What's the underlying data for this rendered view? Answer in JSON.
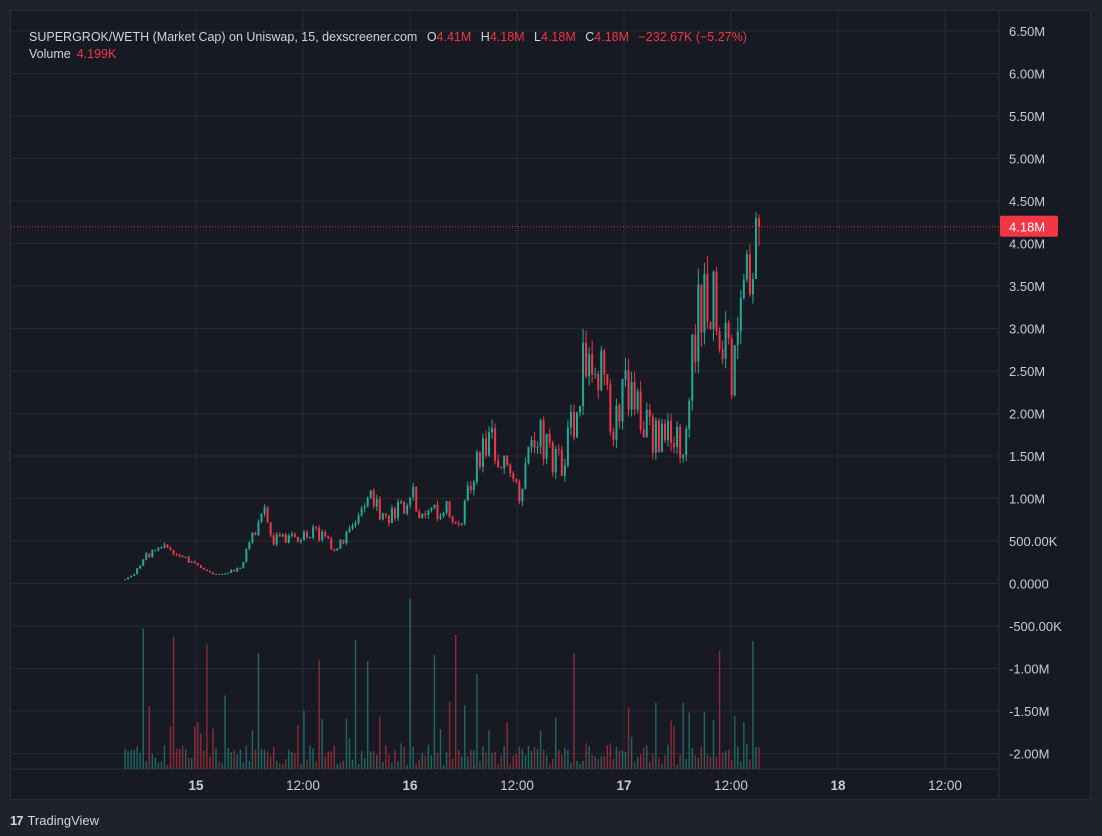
{
  "legend": {
    "title": "SUPERGROK/WETH (Market Cap) on Uniswap, 15, dexscreener.com",
    "o_label": "O",
    "o_value": "4.41M",
    "h_label": "H",
    "h_value": "4.18M",
    "l_label": "L",
    "l_value": "4.18M",
    "c_label": "C",
    "c_value": "4.18M",
    "change": "−232.67K (−5.27%)",
    "volume_label": "Volume",
    "volume_value": "4.199K"
  },
  "price_tag": "4.18M",
  "branding": {
    "name": "TradingView",
    "logo_glyph": "17"
  },
  "colors": {
    "up": "#22ab94",
    "down": "#f23645",
    "grid": "#262a35",
    "background": "#171a23"
  },
  "chart_data": {
    "type": "candlestick",
    "y_ticks": [
      "6.50M",
      "6.00M",
      "5.50M",
      "5.00M",
      "4.50M",
      "4.00M",
      "3.50M",
      "3.00M",
      "2.50M",
      "2.00M",
      "1.50M",
      "1.00M",
      "500.00K",
      "0.0000",
      "-500.00K",
      "-1.00M",
      "-1.50M",
      "-2.00M"
    ],
    "x_ticks": [
      {
        "label": "15",
        "bold": true
      },
      {
        "label": "12:00",
        "bold": false
      },
      {
        "label": "16",
        "bold": true
      },
      {
        "label": "12:00",
        "bold": false
      },
      {
        "label": "17",
        "bold": true
      },
      {
        "label": "12:00",
        "bold": false
      },
      {
        "label": "18",
        "bold": true
      },
      {
        "label": "12:00",
        "bold": false
      }
    ],
    "ylim": [
      -2200000,
      6750000
    ],
    "current_value": 4180000,
    "market_cap_path": [
      [
        0.0,
        30000
      ],
      [
        0.01,
        70000
      ],
      [
        0.02,
        150000
      ],
      [
        0.03,
        300000
      ],
      [
        0.05,
        350000
      ],
      [
        0.07,
        450000
      ],
      [
        0.08,
        300000
      ],
      [
        0.1,
        250000
      ],
      [
        0.12,
        150000
      ],
      [
        0.14,
        80000
      ],
      [
        0.18,
        150000
      ],
      [
        0.2,
        500000
      ],
      [
        0.22,
        800000
      ],
      [
        0.23,
        500000
      ],
      [
        0.27,
        500000
      ],
      [
        0.3,
        600000
      ],
      [
        0.33,
        400000
      ],
      [
        0.36,
        600000
      ],
      [
        0.39,
        1000000
      ],
      [
        0.41,
        700000
      ],
      [
        0.44,
        900000
      ],
      [
        0.45,
        1100000
      ],
      [
        0.47,
        700000
      ],
      [
        0.5,
        900000
      ],
      [
        0.53,
        700000
      ],
      [
        0.55,
        1300000
      ],
      [
        0.57,
        1700000
      ],
      [
        0.59,
        1500000
      ],
      [
        0.62,
        1000000
      ],
      [
        0.65,
        1800000
      ],
      [
        0.67,
        1500000
      ],
      [
        0.69,
        1400000
      ],
      [
        0.71,
        2000000
      ],
      [
        0.73,
        2900000
      ],
      [
        0.75,
        2500000
      ],
      [
        0.77,
        1800000
      ],
      [
        0.79,
        2300000
      ],
      [
        0.81,
        2100000
      ],
      [
        0.83,
        1700000
      ],
      [
        0.86,
        1800000
      ],
      [
        0.88,
        1600000
      ],
      [
        0.9,
        3000000
      ],
      [
        0.92,
        3500000
      ],
      [
        0.94,
        3000000
      ],
      [
        0.96,
        2400000
      ],
      [
        0.98,
        3500000
      ],
      [
        1.0,
        4180000
      ]
    ]
  }
}
